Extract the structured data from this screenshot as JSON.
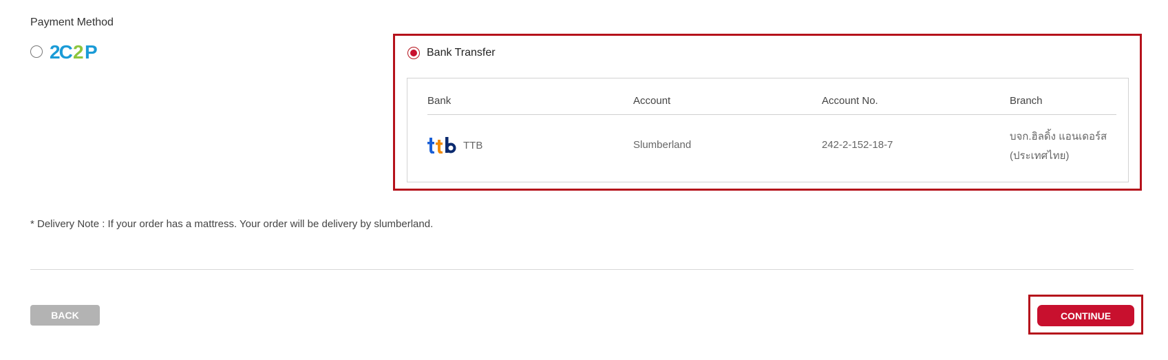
{
  "payment": {
    "title": "Payment Method",
    "options": [
      {
        "logo_text": "2C2P",
        "icon": "2c2p-logo-icon",
        "selected": false
      },
      {
        "label": "Bank Transfer",
        "selected": true
      }
    ]
  },
  "bank_table": {
    "headers": [
      "Bank",
      "Account",
      "Account No.",
      "Branch"
    ],
    "rows": [
      {
        "bank": "TTB",
        "bank_icon": "ttb-logo-icon",
        "account": "Slumberland",
        "account_no": "242-2-152-18-7",
        "branch_line1": "บจก.ฮิลดิ้ง แอนเดอร์ส",
        "branch_line2": "(ประเทศไทย)"
      }
    ]
  },
  "delivery_note": "* Delivery Note : If your order has a mattress. Your order will be delivery by slumberland.",
  "buttons": {
    "back": "BACK",
    "continue": "CONTINUE"
  },
  "colors": {
    "accent": "#c8102e",
    "highlight_border": "#b5121b",
    "back_button": "#b3b3b3",
    "logo_2c2p_blue": "#1a9bd7",
    "logo_2c2p_green": "#8dc63f",
    "ttb_navy": "#0b2a6f",
    "ttb_orange": "#f38b00"
  }
}
